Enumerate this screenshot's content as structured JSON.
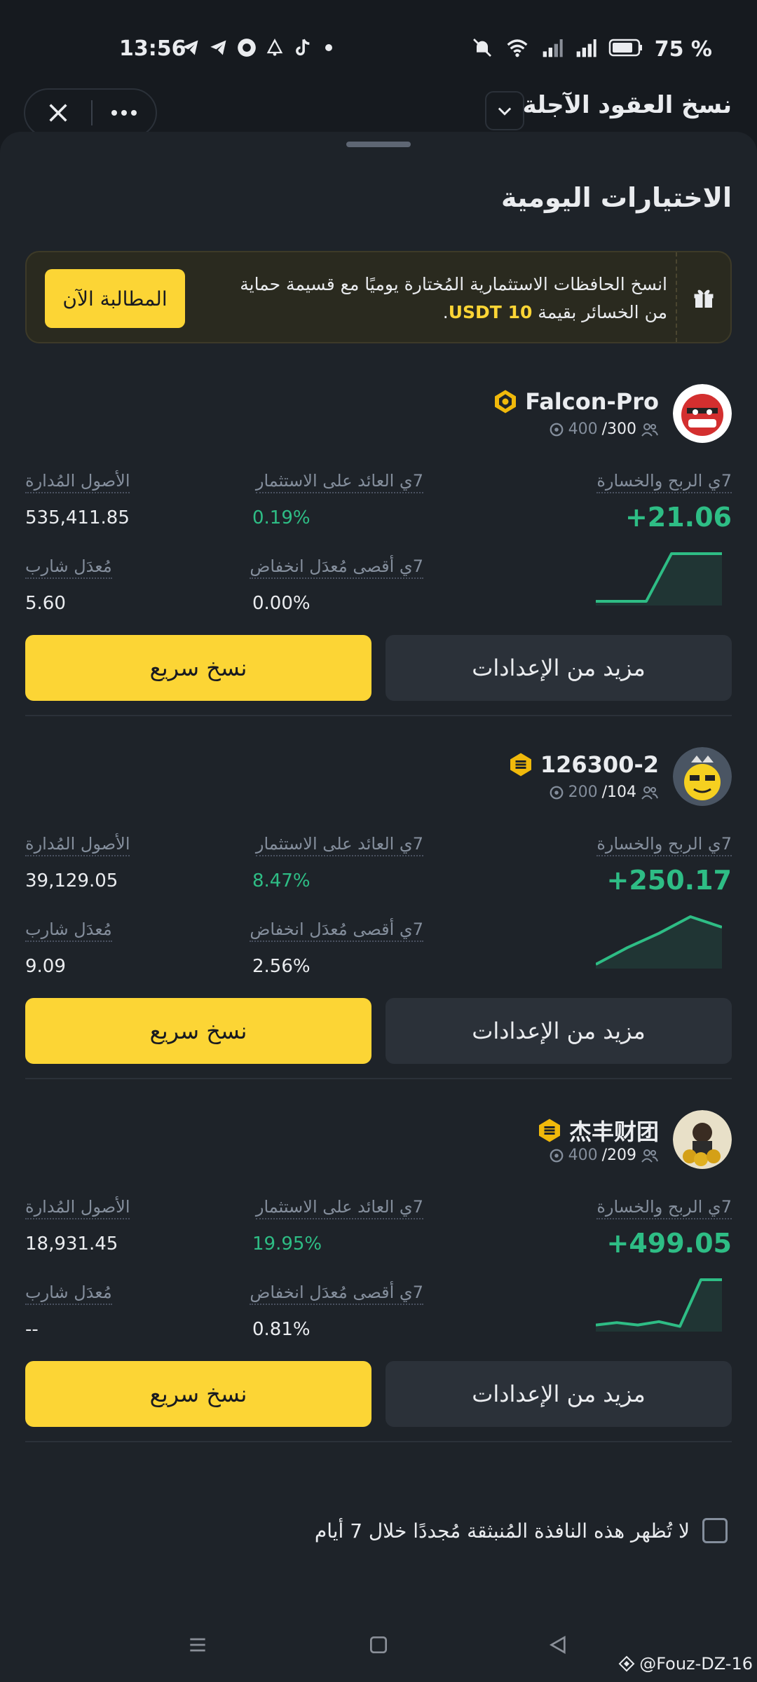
{
  "status_bar": {
    "time": "13:56",
    "battery_pct": "75 %",
    "icons": [
      "telegram-icon",
      "telegram-icon",
      "circle-app-icon",
      "alarm-icon",
      "tiktok-icon",
      "notification-dot",
      "mute-icon",
      "wifi-icon",
      "signal-icon",
      "signal-icon",
      "battery-icon"
    ]
  },
  "header": {
    "title": "نسخ العقود الآجلة"
  },
  "sheet": {
    "title": "الاختيارات اليومية",
    "promo": {
      "text_before": "انسخ الحافظات الاستثمارية المُختارة يوميًا مع قسيمة حماية من الخسائر بقيمة ",
      "highlight": "10 USDT",
      "text_after": ".",
      "claim_label": "المطالبة الآن"
    },
    "labels": {
      "pnl": "7ي الربح والخسارة",
      "roi": "7ي العائد على الاستثمار",
      "aum": "الأصول المُدارة",
      "mdd": "7ي أقصى مُعدَل انخفاض",
      "sharpe": "مُعدَل شارب",
      "copy_btn": "نسخ سريع",
      "settings_btn": "مزيد من الإعدادات"
    },
    "traders": [
      {
        "name": "Falcon-Pro",
        "followers_current": "400",
        "followers_max": "/300",
        "pnl": "+21.06",
        "roi": "0.19%",
        "aum": "535,411.85",
        "mdd": "0.00%",
        "sharpe": "5.60",
        "spark": [
          0,
          0,
          0,
          1,
          1,
          1
        ]
      },
      {
        "name": "126300-2",
        "followers_current": "200",
        "followers_max": "/104",
        "pnl": "+250.17",
        "roi": "8.47%",
        "aum": "39,129.05",
        "mdd": "2.56%",
        "sharpe": "9.09",
        "spark": [
          0,
          0.35,
          0.65,
          1,
          0.78
        ]
      },
      {
        "name": "杰丰财团",
        "followers_current": "400",
        "followers_max": "/209",
        "pnl": "+499.05",
        "roi": "19.95%",
        "aum": "18,931.45",
        "mdd": "0.81%",
        "sharpe": "--",
        "spark": [
          0.05,
          0.1,
          0.05,
          0.12,
          0.02,
          1,
          1
        ]
      }
    ],
    "dont_show": "لا تُظهر هذه النافذة المُنبثقة مُجددًا خلال 7 أيام"
  },
  "watermark": "@Fouz-DZ-16",
  "colors": {
    "accent": "#fcd535",
    "positive": "#2ebd85",
    "sheet_bg": "#1e2329",
    "page_bg": "#161a1f"
  }
}
